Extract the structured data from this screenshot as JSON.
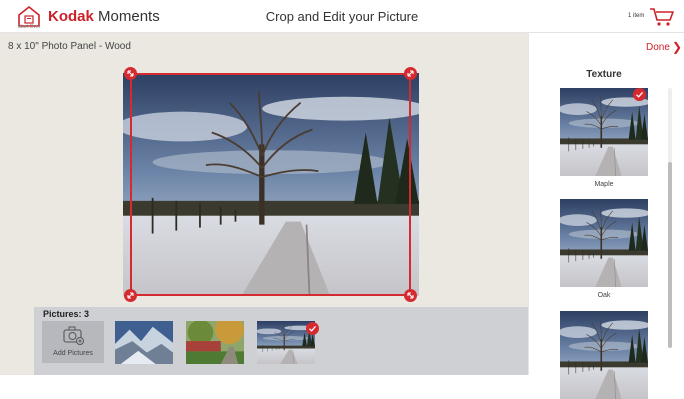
{
  "header": {
    "home_label": "Start Over",
    "brand_kodak": "Kodak",
    "brand_moments": "Moments",
    "title": "Crop and Edit your Picture",
    "cart_count": "1 item"
  },
  "editor": {
    "product_name": "8 x 10\" Photo Panel - Wood"
  },
  "thumbnails": {
    "label": "Pictures: 3",
    "add_label": "Add Pictures"
  },
  "sidebar": {
    "done_label": "Done",
    "chevron": "❯",
    "texture_title": "Texture",
    "textures": [
      {
        "label": "Maple",
        "selected": true
      },
      {
        "label": "Oak",
        "selected": false
      },
      {
        "label": "",
        "selected": false
      }
    ]
  },
  "colors": {
    "accent": "#cc2229",
    "editor_bg": "#ebe8e2",
    "thumbbar_bg": "#cfd0d4"
  },
  "icons": {
    "home": "home-icon",
    "cart": "cart-icon",
    "camera": "camera-add-icon",
    "resize": "resize-diagonal-icon",
    "check": "check-icon"
  }
}
